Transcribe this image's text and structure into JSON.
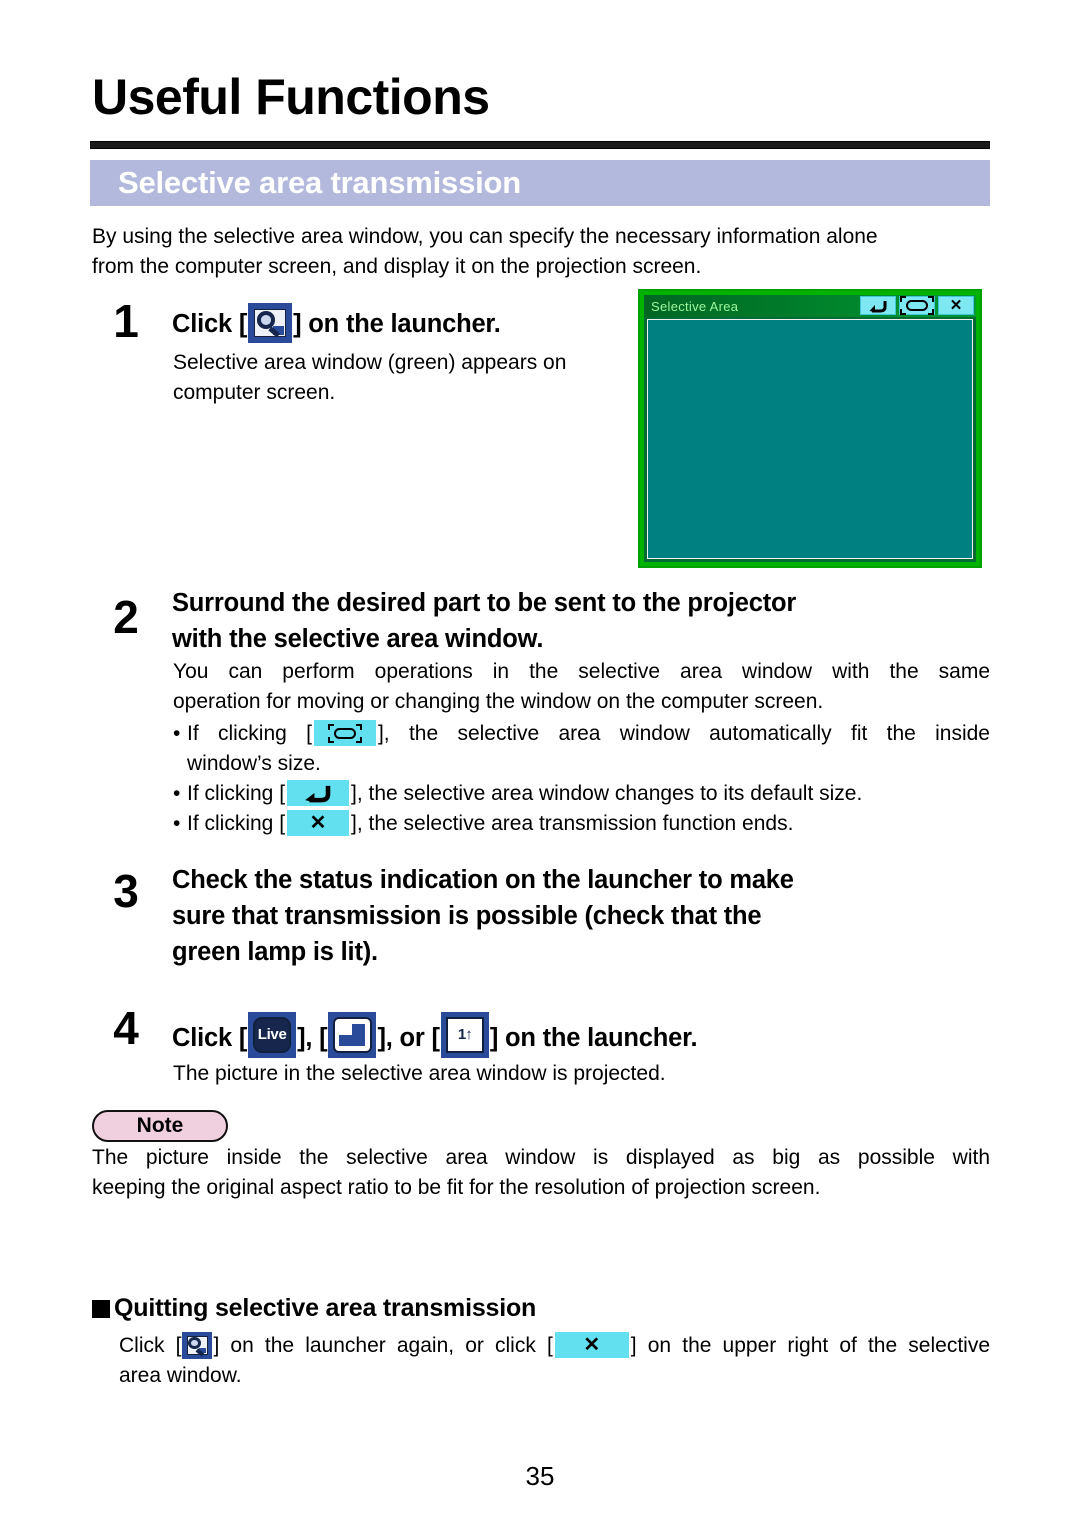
{
  "document": {
    "chapter_title": "Useful Functions",
    "section_title": "Selective area transmission",
    "page_number": "35"
  },
  "intro": {
    "line1": "By using the selective area window, you can specify the necessary information alone",
    "line2": "from the computer screen, and display it on the projection screen."
  },
  "steps": [
    {
      "number": "1",
      "heading_before": "Click [",
      "heading_after": "] on the launcher.",
      "icon": "launcher-selective-area-icon",
      "body_line1": "Selective area window (green) appears on",
      "body_line2": "computer screen."
    },
    {
      "number": "2",
      "heading_line1": "Surround the desired part to be sent to the projector",
      "heading_line2": "with the selective area window.",
      "body_line1": "You can perform operations in the selective area window with the same",
      "body_line2": "operation for moving or changing the window on the computer screen.",
      "bullets": [
        {
          "before": "If clicking [",
          "icon": "fit-window-icon",
          "after": "], the selective area window automatically fit the inside",
          "cont": "window’s size."
        },
        {
          "before": "If clicking [",
          "icon": "default-size-back-arrow-icon",
          "after": "], the selective area window changes to its default size."
        },
        {
          "before": "If clicking [",
          "icon": "close-x-icon",
          "after": "], the selective area transmission function ends."
        }
      ]
    },
    {
      "number": "3",
      "heading_line1": "Check the status indication on the launcher to make",
      "heading_line2": "sure that transmission is possible (check that the",
      "heading_line3": "green lamp is lit)."
    },
    {
      "number": "4",
      "heading_p1": "Click [",
      "heading_p2": "], [",
      "heading_p3": "], or [",
      "heading_p4": "] on the launcher.",
      "icons": [
        "live-icon",
        "multi-layout-icon",
        "one-up-icon"
      ],
      "body_line1": "The picture in the selective area window is projected."
    }
  ],
  "selective_area_window": {
    "title": "Selective Area",
    "buttons": [
      {
        "name": "default-size-back-arrow-icon",
        "label": ""
      },
      {
        "name": "fit-window-icon",
        "label": ""
      },
      {
        "name": "close-x-icon",
        "label": "✕"
      }
    ],
    "colors": {
      "border": "#00b300",
      "titlebar": "#006622",
      "title_text": "#9ef79e",
      "body": "#008080",
      "button": "#7de8f2"
    }
  },
  "note": {
    "badge_label": "Note",
    "line1": "The picture inside the selective area window is displayed as big as possible with",
    "line2": "keeping the original aspect ratio to be fit for the resolution of projection screen."
  },
  "quitting": {
    "heading": "Quitting selective area transmission",
    "text_p1": "Click [",
    "text_p2": "] on the launcher again, or click [",
    "text_p3": "] on the upper right of the selective",
    "text_p4": "area window.",
    "icon1": "launcher-selective-area-icon",
    "icon2": "close-x-icon"
  },
  "icons": {
    "live_label": "Live",
    "one_up_label": "1↑",
    "close_x": "✕"
  },
  "colors": {
    "band": "#b2b9dc",
    "launcher_blue": "#2a4a9a",
    "cyan_button": "#62e0ef",
    "note_pink": "#f0cfdf"
  }
}
